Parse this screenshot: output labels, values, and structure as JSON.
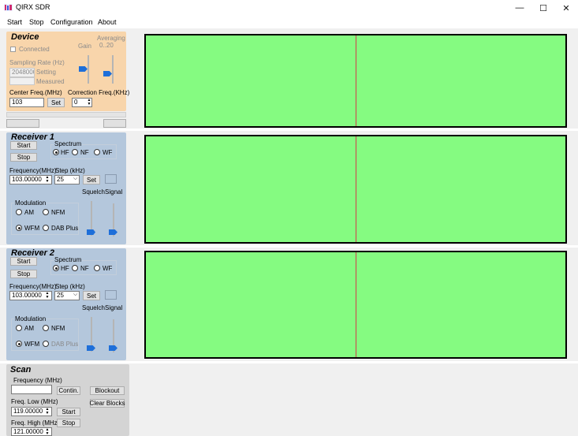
{
  "window": {
    "title": "QIRX SDR",
    "minimize": "—",
    "maximize": "☐",
    "close": "✕",
    "app_icon": "qirx-logo-icon"
  },
  "menu": [
    "Start",
    "Stop",
    "Configuration",
    "About"
  ],
  "colors": {
    "device_bg": "#f8d5ab",
    "receiver_bg": "#b4c7dc",
    "scan_bg": "#d4d4d4",
    "scope_fill": "#85fb81",
    "scope_marker": "#d0404a",
    "slider_thumb": "#1e6fd9"
  },
  "device": {
    "title": "Device",
    "averaging_label": "Averaging",
    "averaging_value": "0..20",
    "gain_label": "Gain",
    "connected_label": "Connected",
    "connected": false,
    "sampling_label": "Sampling Rate (Hz)",
    "sampling_value": "2048000",
    "setting_label": "Setting",
    "measured_label": "Measured",
    "center_freq_label": "Center Freq.(MHz)",
    "center_freq_value": "103",
    "set_label": "Set",
    "correction_label": "Correction Freq.(KHz)",
    "correction_value": "0"
  },
  "receivers": [
    {
      "title": "Receiver 1",
      "start_label": "Start",
      "stop_label": "Stop",
      "spectrum_label": "Spectrum",
      "spectrum_options": [
        "HF",
        "NF",
        "WF"
      ],
      "spectrum_selected": "HF",
      "frequency_label": "Frequency(MHz)",
      "frequency_value": "103.00000",
      "step_label": "Step (kHz)",
      "step_value": "25",
      "set_label": "Set",
      "squelch_label": "Squelch",
      "signal_label": "Signal",
      "modulation_label": "Modulation",
      "modulation_options": [
        "AM",
        "NFM",
        "WFM",
        "DAB Plus"
      ],
      "modulation_selected": "WFM"
    },
    {
      "title": "Receiver 2",
      "start_label": "Start",
      "stop_label": "Stop",
      "spectrum_label": "Spectrum",
      "spectrum_options": [
        "HF",
        "NF",
        "WF"
      ],
      "spectrum_selected": "HF",
      "frequency_label": "Frequency(MHz)",
      "frequency_value": "103.00000",
      "step_label": "Step (kHz)",
      "step_value": "25",
      "set_label": "Set",
      "squelch_label": "Squelch",
      "signal_label": "Signal",
      "modulation_label": "Modulation",
      "modulation_options": [
        "AM",
        "NFM",
        "WFM",
        "DAB Plus"
      ],
      "modulation_selected": "WFM"
    }
  ],
  "scan": {
    "title": "Scan",
    "frequency_label": "Frequency (MHz)",
    "frequency_value": "",
    "contin_label": "Contin.",
    "blockout_label": "Blockout",
    "clear_blocks_label": "Clear Blocks",
    "freq_low_label": "Freq. Low (MHz)",
    "freq_low_value": "119.00000",
    "start_label": "Start",
    "freq_high_label": "Freq. High (MHz)",
    "freq_high_value": "121.00000",
    "stop_label": "Stop"
  }
}
